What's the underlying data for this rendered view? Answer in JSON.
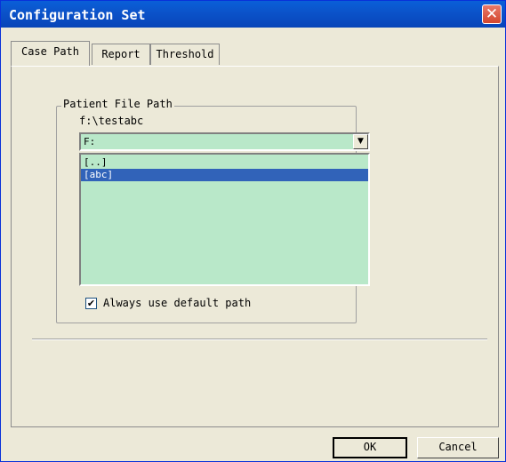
{
  "window": {
    "title": "Configuration Set",
    "close_glyph": "✕"
  },
  "tabs": [
    {
      "label": "Case Path",
      "active": true
    },
    {
      "label": "Report",
      "active": false
    },
    {
      "label": "Threshold",
      "active": false
    }
  ],
  "patient_file_path": {
    "group_label": "Patient File Path",
    "current_path": "f:\\testabc",
    "drive_select": {
      "value": "F:",
      "arrow_icon": "▼"
    },
    "directory_list": [
      {
        "label": "[..]",
        "selected": false
      },
      {
        "label": "[abc]",
        "selected": true
      }
    ],
    "always_default": {
      "label": "Always use default path",
      "checked": true,
      "mark": "✔"
    }
  },
  "buttons": {
    "ok": "OK",
    "cancel": "Cancel"
  },
  "colors": {
    "titlebar": "#0b52c9",
    "list_bg": "#b9e8c9",
    "selection": "#3163b9"
  }
}
